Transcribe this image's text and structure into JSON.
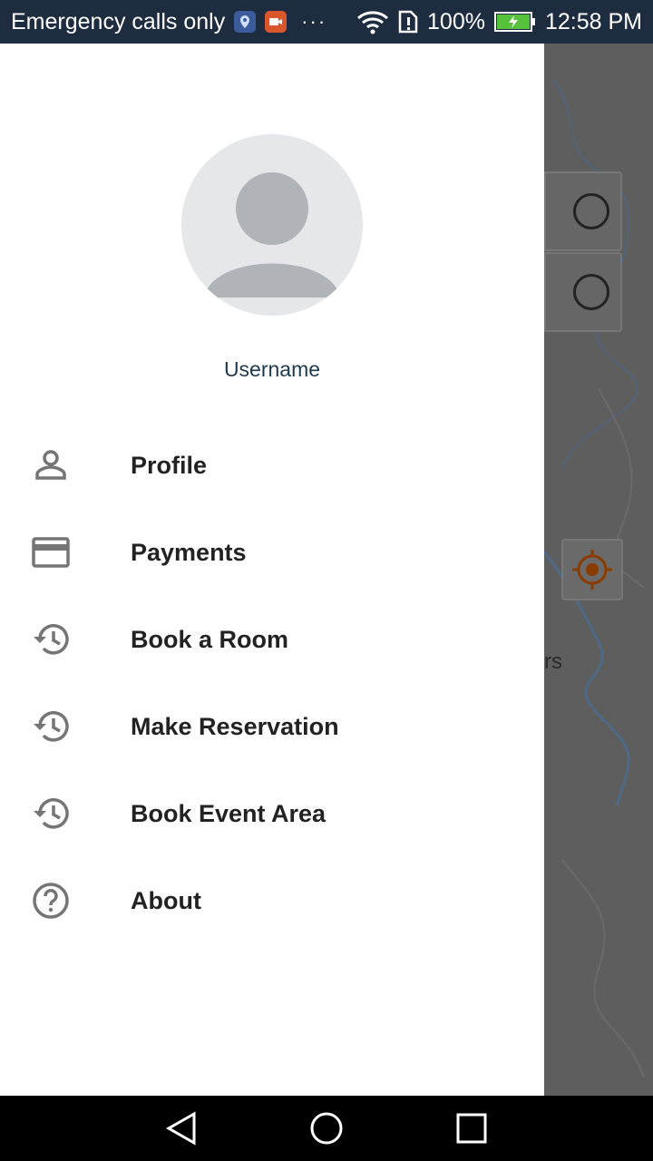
{
  "status_bar": {
    "carrier_text": "Emergency calls only",
    "battery_percent": "100%",
    "time": "12:58 PM",
    "icons": [
      "location-icon",
      "recorder-icon",
      "more-dots-icon",
      "wifi-icon",
      "sim-alert-icon",
      "battery-icon"
    ]
  },
  "drawer": {
    "username": "Username",
    "menu_items": [
      {
        "label": "Profile",
        "icon": "person-icon"
      },
      {
        "label": "Payments",
        "icon": "credit-card-icon"
      },
      {
        "label": "Book a Room",
        "icon": "history-icon"
      },
      {
        "label": "Make Reservation",
        "icon": "history-icon"
      },
      {
        "label": "Book Event Area",
        "icon": "history-icon"
      },
      {
        "label": "About",
        "icon": "help-circle-icon"
      }
    ]
  },
  "map": {
    "partial_label": "rs"
  },
  "nav_bar": {
    "buttons": [
      "back-icon",
      "home-icon",
      "recents-icon"
    ]
  },
  "colors": {
    "status_bar_bg": "#1d2d3f",
    "drawer_bg": "#ffffff",
    "scrim": "#5f5f5f",
    "username_text": "#1e3a4f",
    "menu_text": "#222222",
    "icon_gray": "#757575",
    "locate_orange": "#c25a00"
  }
}
